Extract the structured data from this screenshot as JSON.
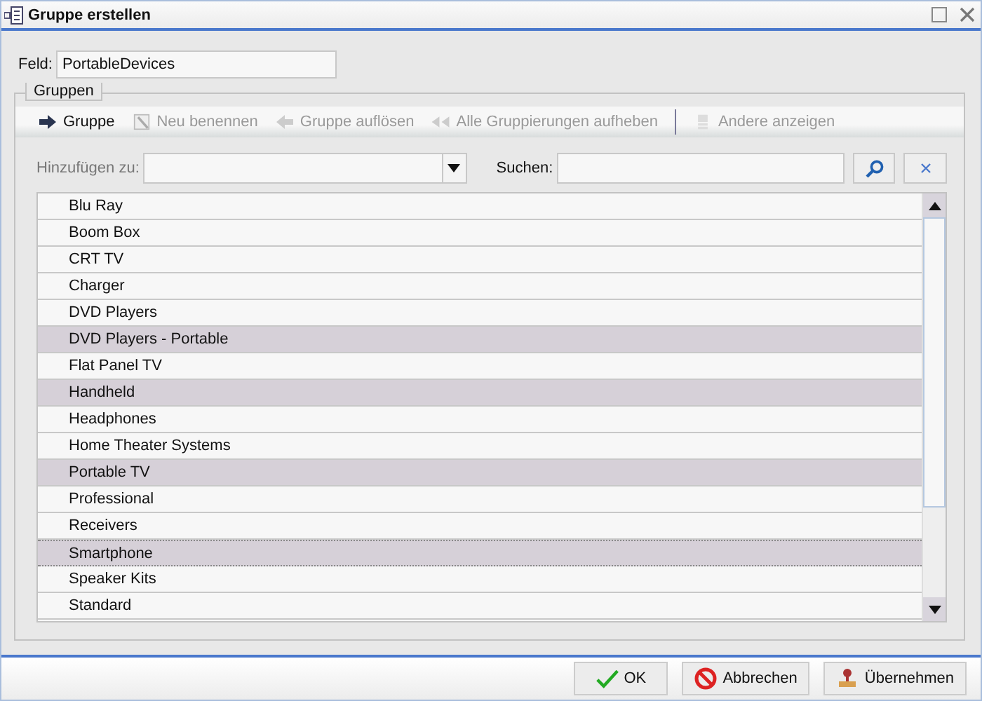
{
  "window": {
    "title": "Gruppe erstellen"
  },
  "field": {
    "label": "Feld:",
    "value": "PortableDevices"
  },
  "groups": {
    "legend": "Gruppen",
    "toolbar": [
      {
        "label": "Gruppe",
        "kind": "arrow",
        "disabled": false
      },
      {
        "label": "Neu benennen",
        "kind": "rename",
        "disabled": true
      },
      {
        "label": "Gruppe auflösen",
        "kind": "left",
        "disabled": true
      },
      {
        "label": "Alle Gruppierungen aufheben",
        "kind": "double-left",
        "disabled": true
      },
      {
        "label": "Andere anzeigen",
        "kind": "stack",
        "disabled": true
      }
    ],
    "add_to": {
      "label": "Hinzufügen zu:"
    },
    "search": {
      "label": "Suchen:"
    },
    "items": [
      {
        "label": "Blu Ray",
        "selected": false,
        "focused": false
      },
      {
        "label": "Boom Box",
        "selected": false,
        "focused": false
      },
      {
        "label": "CRT TV",
        "selected": false,
        "focused": false
      },
      {
        "label": "Charger",
        "selected": false,
        "focused": false
      },
      {
        "label": "DVD Players",
        "selected": false,
        "focused": false
      },
      {
        "label": "DVD Players - Portable",
        "selected": true,
        "focused": false
      },
      {
        "label": "Flat Panel TV",
        "selected": false,
        "focused": false
      },
      {
        "label": "Handheld",
        "selected": true,
        "focused": false
      },
      {
        "label": "Headphones",
        "selected": false,
        "focused": false
      },
      {
        "label": "Home Theater Systems",
        "selected": false,
        "focused": false
      },
      {
        "label": "Portable TV",
        "selected": true,
        "focused": false
      },
      {
        "label": "Professional",
        "selected": false,
        "focused": false
      },
      {
        "label": "Receivers",
        "selected": false,
        "focused": false
      },
      {
        "label": "Smartphone",
        "selected": true,
        "focused": true
      },
      {
        "label": "Speaker Kits",
        "selected": false,
        "focused": false
      },
      {
        "label": "Standard",
        "selected": false,
        "focused": false
      }
    ]
  },
  "buttons": [
    {
      "label": "OK",
      "kind": "check"
    },
    {
      "label": "Abbrechen",
      "kind": "cancel"
    },
    {
      "label": "Übernehmen",
      "kind": "stamp"
    }
  ]
}
